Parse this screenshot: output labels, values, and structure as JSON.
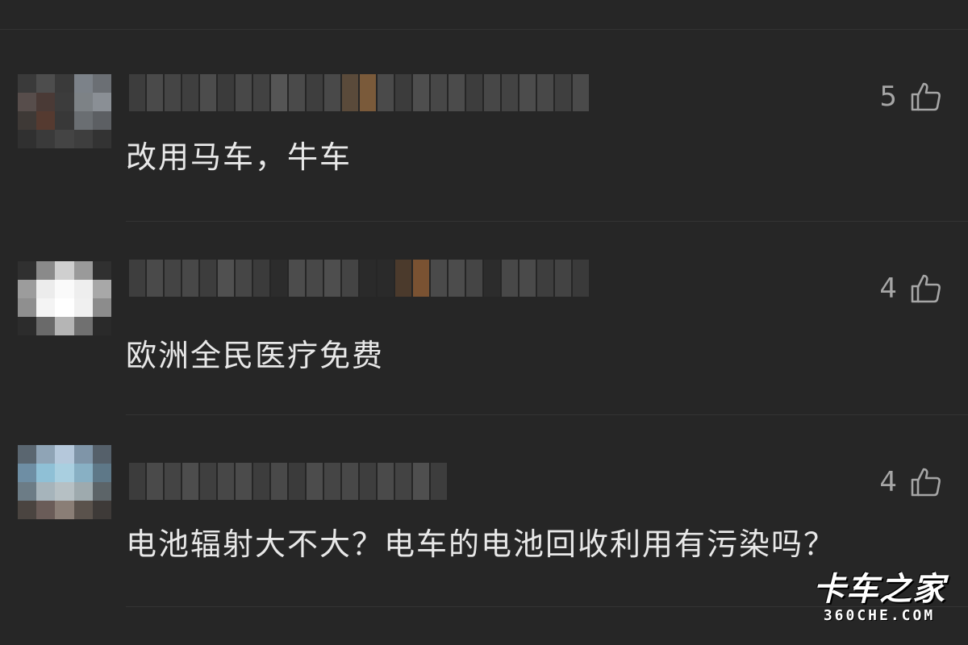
{
  "comments": [
    {
      "text": "改用马车，牛车",
      "likes": "5",
      "avatar_colors": [
        "#3a3a3a",
        "#4d4d4d",
        "#3a3a3a",
        "#7c8289",
        "#6b6f74",
        "#574d4b",
        "#4a3a36",
        "#3c3c3c",
        "#7d8286",
        "#8a8f95",
        "#3e3936",
        "#553a30",
        "#383838",
        "#6a6e72",
        "#5c5f63",
        "#303030",
        "#3a3a3a",
        "#444444",
        "#3e3e3e",
        "#333333"
      ],
      "username_colors": [
        "#3d3d3d",
        "#4a4a4a",
        "#454545",
        "#3f3f3f",
        "#4c4c4c",
        "#3b3b3b",
        "#484848",
        "#424242",
        "#555555",
        "#4a4a4a",
        "#3e3e3e",
        "#494949",
        "#5a4a3a",
        "#7a5a3a",
        "#4a4a4a",
        "#3c3c3c",
        "#4e4e4e",
        "#474747",
        "#4b4b4b",
        "#3d3d3d",
        "#474747",
        "#434343",
        "#4c4c4c",
        "#484848",
        "#3f3f3f",
        "#4a4a4a"
      ]
    },
    {
      "text": "欧洲全民医疗免费",
      "likes": "4",
      "avatar_colors": [
        "#303030",
        "#8a8a8a",
        "#cfcfcf",
        "#9a9a9a",
        "#303030",
        "#9c9c9c",
        "#ececec",
        "#fafafa",
        "#eeeeee",
        "#a8a8a8",
        "#8f8f8f",
        "#f4f4f4",
        "#ffffff",
        "#f0f0f0",
        "#8c8c8c",
        "#2c2c2c",
        "#6a6a6a",
        "#b5b5b5",
        "#707070",
        "#2a2a2a"
      ],
      "username_colors": [
        "#3e3e3e",
        "#4a4a4a",
        "#444444",
        "#484848",
        "#3d3d3d",
        "#505050",
        "#464646",
        "#3b3b3b",
        "#2c2c2c",
        "#4c4c4c",
        "#484848",
        "#4e4e4e",
        "#444444",
        "#2a2a2a",
        "#2a2a2a",
        "#4b3a2c",
        "#7a5232",
        "#4a4a4a",
        "#4c4c4c",
        "#454545",
        "#2c2c2c",
        "#484848",
        "#4a4a4a",
        "#3e3e3e",
        "#434343",
        "#3a3a3a"
      ]
    },
    {
      "text": "电池辐射大不大？电车的电池回收利用有污染吗？",
      "likes": "4",
      "avatar_colors": [
        "#5a6670",
        "#8fa4b6",
        "#b5c8db",
        "#7f95a8",
        "#55606a",
        "#6e8ea4",
        "#8fc0d6",
        "#a9cfe0",
        "#88b0c4",
        "#5e7888",
        "#6c7c86",
        "#a6b4bb",
        "#b6c0c4",
        "#9eaaae",
        "#5c6468",
        "#4a4440",
        "#6a5c58",
        "#8a7e76",
        "#5a524c",
        "#3e3a38"
      ],
      "username_colors": [
        "#3c3c3c",
        "#4a4a4a",
        "#444444",
        "#4d4d4d",
        "#3f3f3f",
        "#474747",
        "#4b4b4b",
        "#3d3d3d",
        "#494949",
        "#3b3b3b",
        "#4c4c4c",
        "#454545",
        "#484848",
        "#3e3e3e",
        "#4a4a4a",
        "#434343",
        "#4f4f4f",
        "#3d3d3d"
      ]
    }
  ],
  "watermark": {
    "brand": "卡车之家",
    "domain": "360CHE.COM"
  },
  "icons": {
    "like": "thumbs-up-icon"
  }
}
